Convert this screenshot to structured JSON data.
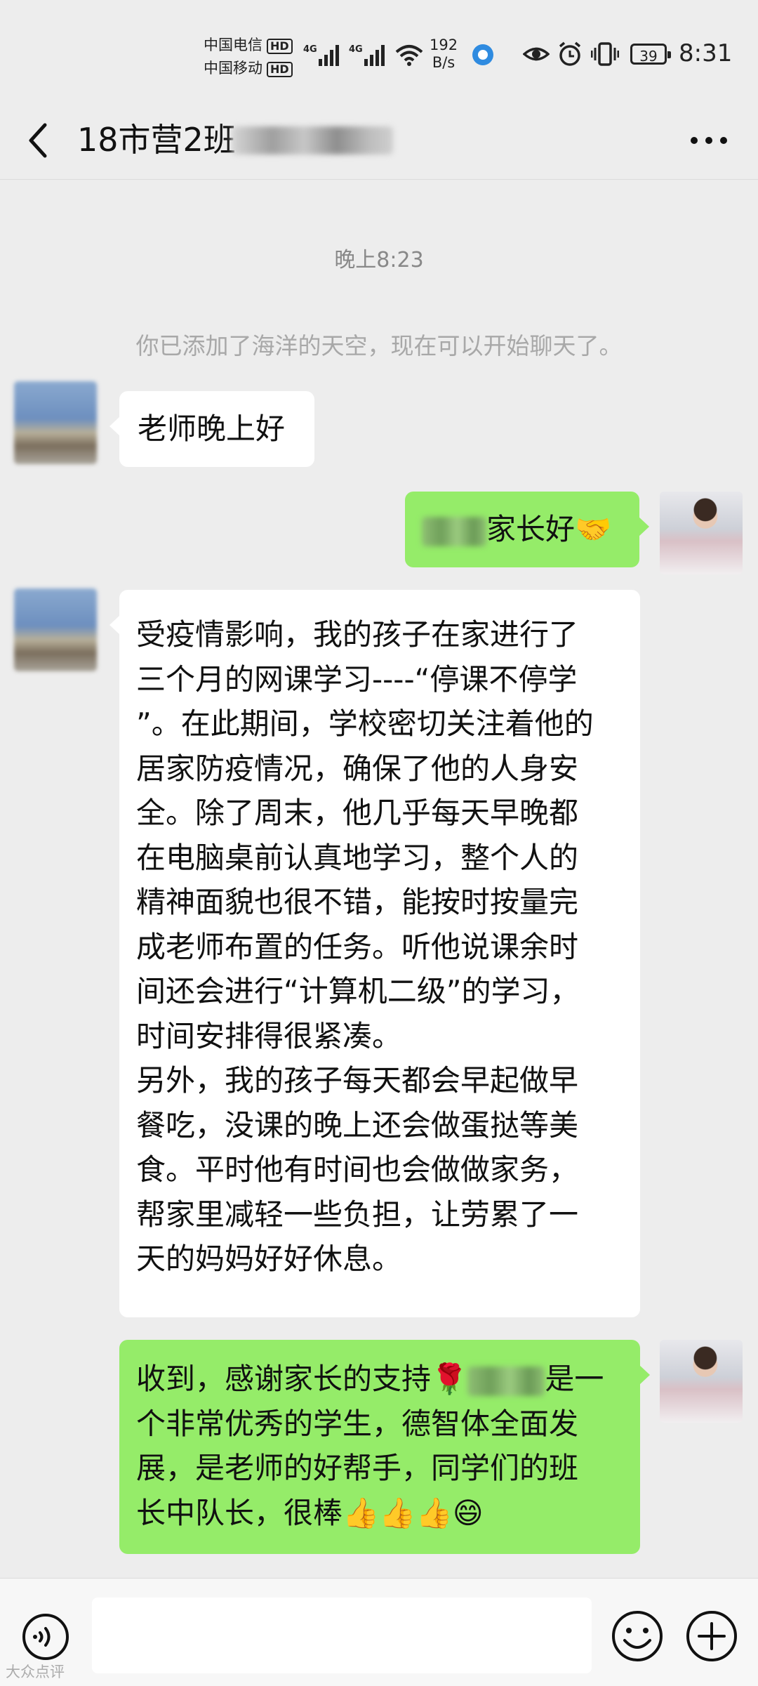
{
  "status_bar": {
    "carrier_1": "中国电信",
    "carrier_2": "中国移动",
    "hd_badge": "HD",
    "net_speed_value": "192",
    "net_speed_unit": "B/s",
    "battery": "39",
    "time": "8:31"
  },
  "header": {
    "title": "18市营2班"
  },
  "chat": {
    "timestamp": "晚上8:23",
    "system_message": "你已添加了海洋的天空，现在可以开始聊天了。",
    "messages": [
      {
        "side": "left",
        "text": "老师晚上好"
      },
      {
        "side": "right",
        "text_after_name": "家长好",
        "emoji": "🤝"
      },
      {
        "side": "left",
        "lines": [
          "受疫情影响，我的孩子在家进行了",
          "三个月的网课学习----“停课不停学",
          "”。在此期间，学校密切关注着他的",
          "居家防疫情况，确保了他的人身安",
          "全。除了周末，他几乎每天早晚都",
          "在电脑桌前认真地学习，整个人的",
          "精神面貌也很不错，能按时按量完",
          "成老师布置的任务。听他说课余时",
          "间还会进行“计算机二级”的学习，",
          "时间安排得很紧凑。",
          "另外，我的孩子每天都会早起做早",
          "餐吃，没课的晚上还会做蛋挞等美",
          "食。平时他有时间也会做做家务，",
          "帮家里减轻一些负担，让劳累了一",
          "天的妈妈好好休息。"
        ]
      },
      {
        "side": "right",
        "line1_before": "收到，感谢家长的支持",
        "line1_emoji": "🌹",
        "line1_after": "是一",
        "line2": "个非常优秀的学生，德智体全面发",
        "line3": "展，是老师的好帮手，同学们的班",
        "line4_text": "长中队长，很棒",
        "line4_emojis": "👍👍👍😄"
      }
    ]
  },
  "watermark": "大众点评"
}
